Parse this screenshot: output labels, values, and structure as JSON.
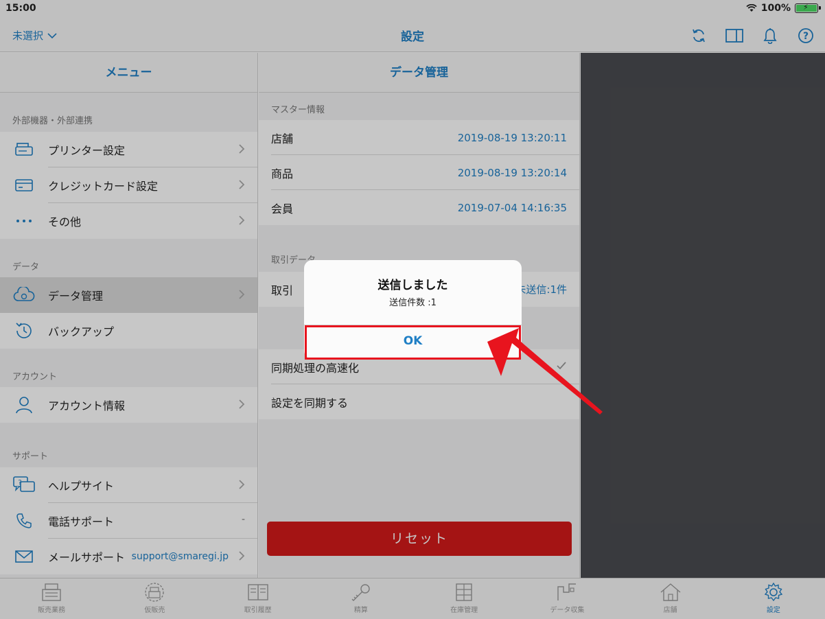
{
  "status": {
    "time": "15:00",
    "battery": "100%"
  },
  "nav": {
    "store_select": "未選択",
    "title": "設定"
  },
  "left": {
    "header": "メニュー",
    "sections": {
      "external": "外部機器・外部連携",
      "data": "データ",
      "account": "アカウント",
      "support": "サポート"
    },
    "items": {
      "printer": "プリンター設定",
      "credit": "クレジットカード設定",
      "other": "その他",
      "data_mgmt": "データ管理",
      "backup": "バックアップ",
      "account_info": "アカウント情報",
      "help": "ヘルプサイト",
      "phone": "電話サポート",
      "phone_value": "-",
      "mail": "メールサポート",
      "mail_value": "support@smaregi.jp"
    }
  },
  "middle": {
    "header": "データ管理",
    "master_label": "マスター情報",
    "master_rows": [
      {
        "label": "店舗",
        "value": "2019-08-19 13:20:11"
      },
      {
        "label": "商品",
        "value": "2019-08-19 13:20:14"
      },
      {
        "label": "会員",
        "value": "2019-07-04 14:16:35"
      }
    ],
    "trans_label": "取引データ",
    "trans_row": {
      "label": "取引",
      "value": "未送信:1件"
    },
    "sync_fast": "同期処理の高速化",
    "sync_settings": "設定を同期する",
    "reset": "リセット"
  },
  "alert": {
    "title": "送信しました",
    "message": "送信件数 :1",
    "ok": "OK"
  },
  "tabs": [
    "販売業務",
    "仮販売",
    "取引履歴",
    "精算",
    "在庫管理",
    "データ収集",
    "店舗",
    "設定"
  ],
  "colors": {
    "accent": "#1f7fc5",
    "reset": "#d21a1a",
    "highlight": "#e8141e"
  }
}
